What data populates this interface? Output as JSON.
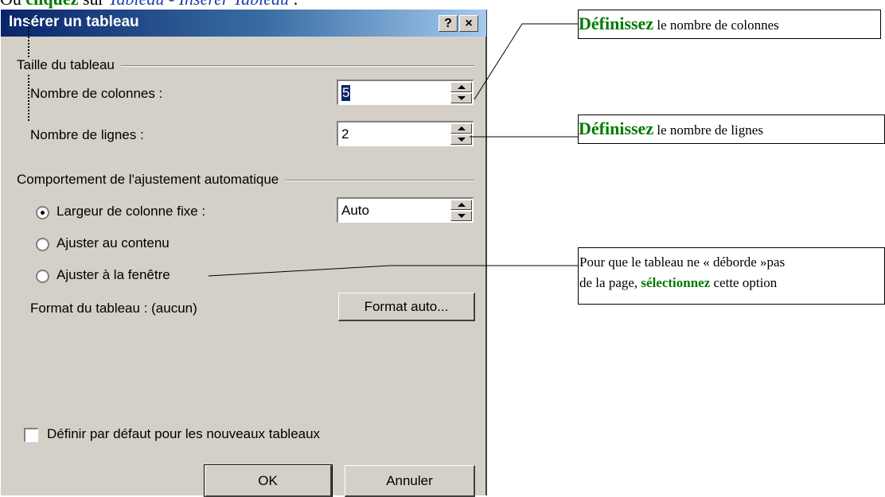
{
  "doc_header": {
    "prefix": "Ou ",
    "emph": "cliquez",
    "middle": " sur ",
    "path": "Tableau - Insérer Tableau",
    "end": " :"
  },
  "dialog": {
    "title": "Insérer un tableau",
    "help_btn": "?",
    "close_btn": "×",
    "size_group": "Taille du tableau",
    "cols_label": "Nombre de colonnes :",
    "cols_value": "5",
    "rows_label": "Nombre de lignes :",
    "rows_value": "2",
    "autofit_group": "Comportement de l'ajustement automatique",
    "opt_fixed": "Largeur de colonne fixe :",
    "fixed_value": "Auto",
    "opt_content": "Ajuster au contenu",
    "opt_window": "Ajuster à la fenêtre",
    "format_label": "Format du tableau : (aucun)",
    "format_btn": "Format auto...",
    "default_check": "Définir par défaut pour les nouveaux tableaux",
    "ok": "OK",
    "cancel": "Annuler"
  },
  "callouts": {
    "cols": {
      "bold": "Définissez",
      "rest": " le nombre de colonnes"
    },
    "rows": {
      "bold": "Définissez",
      "rest": " le nombre de lignes"
    },
    "window": {
      "line1": "Pour que le tableau ne « déborde »pas",
      "line2a": "de la page, ",
      "line2b": "sélectionnez",
      "line2c": " cette option"
    }
  },
  "colors": {
    "accent_green": "#007a00",
    "title_bar": "#0a246a",
    "dialog_bg": "#d4d0c8"
  }
}
